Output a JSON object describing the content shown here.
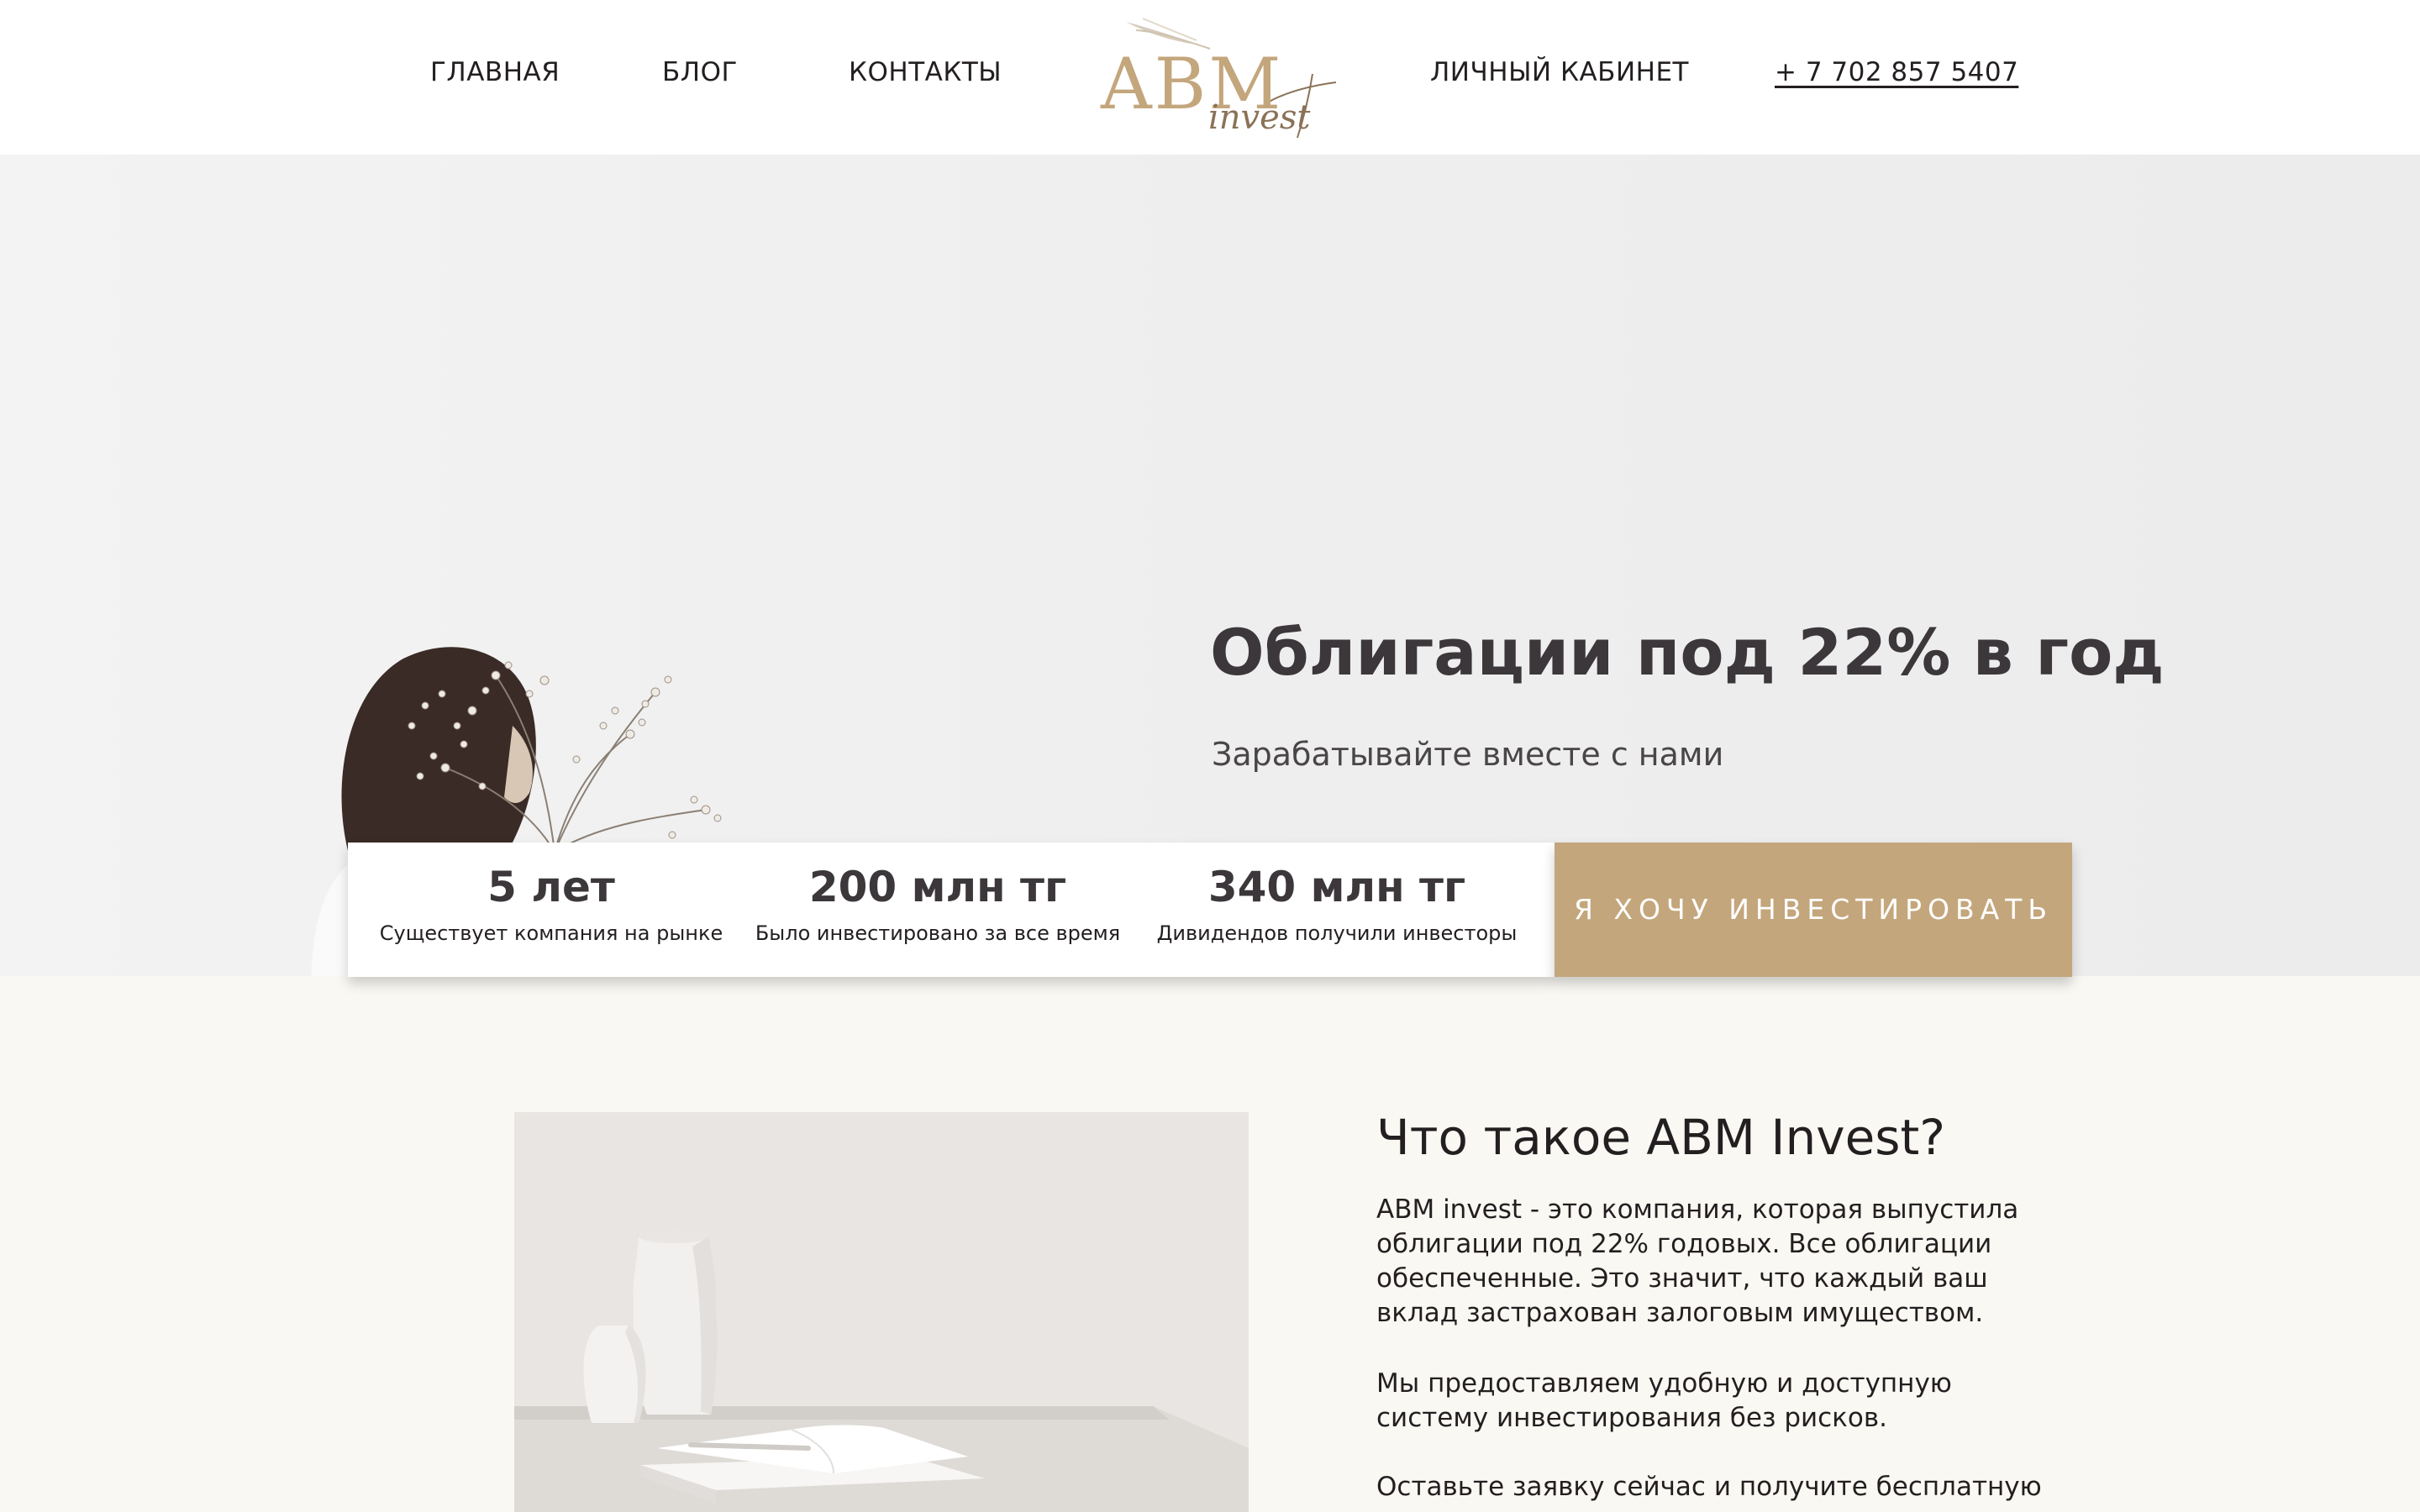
{
  "nav": {
    "home": "ГЛАВНАЯ",
    "blog": "БЛОГ",
    "contacts": "КОНТАКТЫ",
    "account": "ЛИЧНЫЙ КАБИНЕТ",
    "phone": "+ 7 702 857 5407"
  },
  "logo": {
    "main": "ABM",
    "script": "invest"
  },
  "hero": {
    "title": "Облигации под 22% в год",
    "subtitle": "Зарабатывайте вместе с нами"
  },
  "stats": [
    {
      "value": "5 лет",
      "label": "Существует компания на рынке"
    },
    {
      "value": "200 млн тг",
      "label": "Было инвестировано за все время"
    },
    {
      "value": "340 млн тг",
      "label": "Дивидендов получили инвесторы"
    }
  ],
  "cta": {
    "label": "Я ХОЧУ ИНВЕСТИРОВАТЬ"
  },
  "about": {
    "title": "Что такое ABM Invest?",
    "p1": "ABM invest - это компания, которая выпустила облигации под 22% годовых. Все облигации обеспеченные. Это значит, что каждый ваш вклад застрахован залоговым имуществом.",
    "p2": "Мы предоставляем удобную и доступную систему инвестирования без рисков.",
    "p3": "Оставьте заявку сейчас и получите бесплатную"
  },
  "colors": {
    "accent": "#c4a67c",
    "text": "#231f20",
    "heading": "#3b373a",
    "hero_bg": "#efefef",
    "section_bg": "#faf8f3"
  }
}
